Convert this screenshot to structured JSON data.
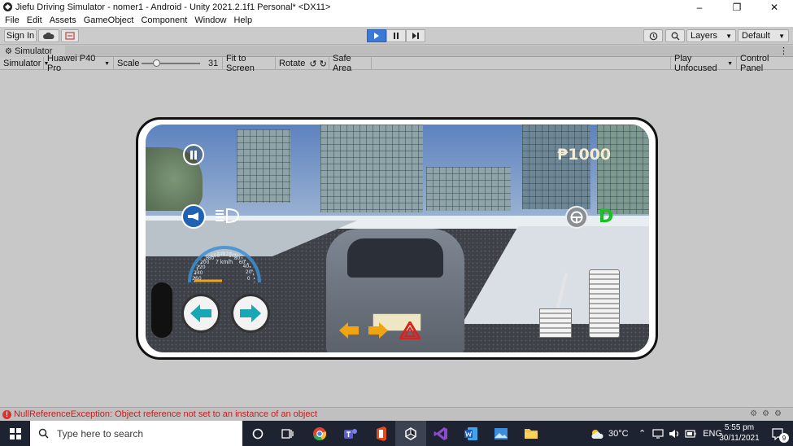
{
  "window": {
    "title": "Jiefu Driving Simulator - nomer1 - Android - Unity 2021.2.1f1 Personal* <DX11>",
    "controls": [
      "–",
      "❐",
      "✕"
    ]
  },
  "menu": [
    "File",
    "Edit",
    "Assets",
    "GameObject",
    "Component",
    "Window",
    "Help"
  ],
  "toolbar": {
    "sign_in": "Sign In",
    "layers": "Layers",
    "layout": "Default"
  },
  "tab": {
    "label": "Simulator"
  },
  "simbar": {
    "mode": "Simulator",
    "device": "Huawei P40 Pro",
    "scale_label": "Scale",
    "scale_value": "31",
    "scale_fraction": 0.27,
    "fit": "Fit to Screen",
    "rotate": "Rotate",
    "safe_area": "Safe Area",
    "play_mode": "Play Unfocused",
    "control_panel": "Control Panel"
  },
  "game": {
    "money": "₱1000",
    "gear": "D",
    "speed": "7 km/h",
    "gauge_ticks": [
      "0",
      "20",
      "40",
      "60",
      "80",
      "100",
      "120",
      "140",
      "160",
      "180",
      "200",
      "220",
      "240",
      "260"
    ]
  },
  "status": {
    "message": "NullReferenceException: Object reference not set to an instance of an object"
  },
  "taskbar": {
    "search_placeholder": "Type here to search",
    "weather": "30°C",
    "language": "ENG",
    "time": "5:55 pm",
    "date": "30/11/2021",
    "notification_count": "9"
  },
  "colors": {
    "play_active": "#3a79d8",
    "error": "#c02020",
    "gear_green": "#16c21f",
    "taskbar": "#1d2330"
  }
}
